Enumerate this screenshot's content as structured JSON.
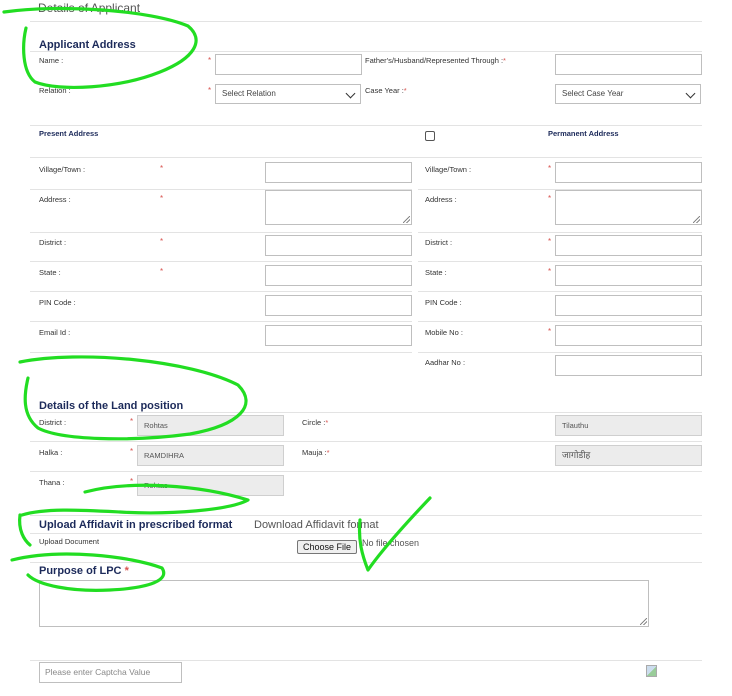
{
  "page_title": "Details of Applicant",
  "applicant": {
    "heading": "Applicant Address",
    "name_label": "Name :",
    "father_label": "Father's/Husband/Represented Through :",
    "relation_label": "Relation :",
    "relation_value": "Select Relation",
    "case_year_label": "Case Year :",
    "case_year_value": "Select Case Year"
  },
  "addresses": {
    "present_label": "Present Address",
    "permanent_label": "Permanent Address",
    "present": {
      "village": "Village/Town :",
      "address": "Address :",
      "district": "District :",
      "state": "State :",
      "pin": "PIN Code :",
      "email": "Email Id :"
    },
    "permanent": {
      "village": "Village/Town :",
      "address": "Address :",
      "district": "District :",
      "state": "State :",
      "pin": "PIN Code :",
      "mobile": "Mobile No :",
      "aadhar": "Aadhar No :"
    }
  },
  "land": {
    "heading": "Details of the Land position",
    "district_label": "District :",
    "district_value": "Rohtas",
    "circle_label": "Circle :",
    "circle_value": "Tilauthu",
    "halka_label": "Halka :",
    "halka_value": "RAMDIHRA",
    "mauja_label": "Mauja :",
    "mauja_value": "जागोडीह",
    "thana_label": "Thana :",
    "thana_value": "Rohtas"
  },
  "affidavit": {
    "heading": "Upload Affidavit in prescribed format",
    "download_link": "Download Affidavit format",
    "upload_label": "Upload Document",
    "choose_button": "Choose File",
    "no_file": "No file chosen"
  },
  "purpose": {
    "heading": "Purpose of LPC",
    "required": "*"
  },
  "captcha": {
    "placeholder": "Please enter Captcha Value"
  },
  "required_mark": "*",
  "colors": {
    "heading": "#1c2a5a",
    "required": "#d9534f",
    "annotation": "#22dd22"
  }
}
